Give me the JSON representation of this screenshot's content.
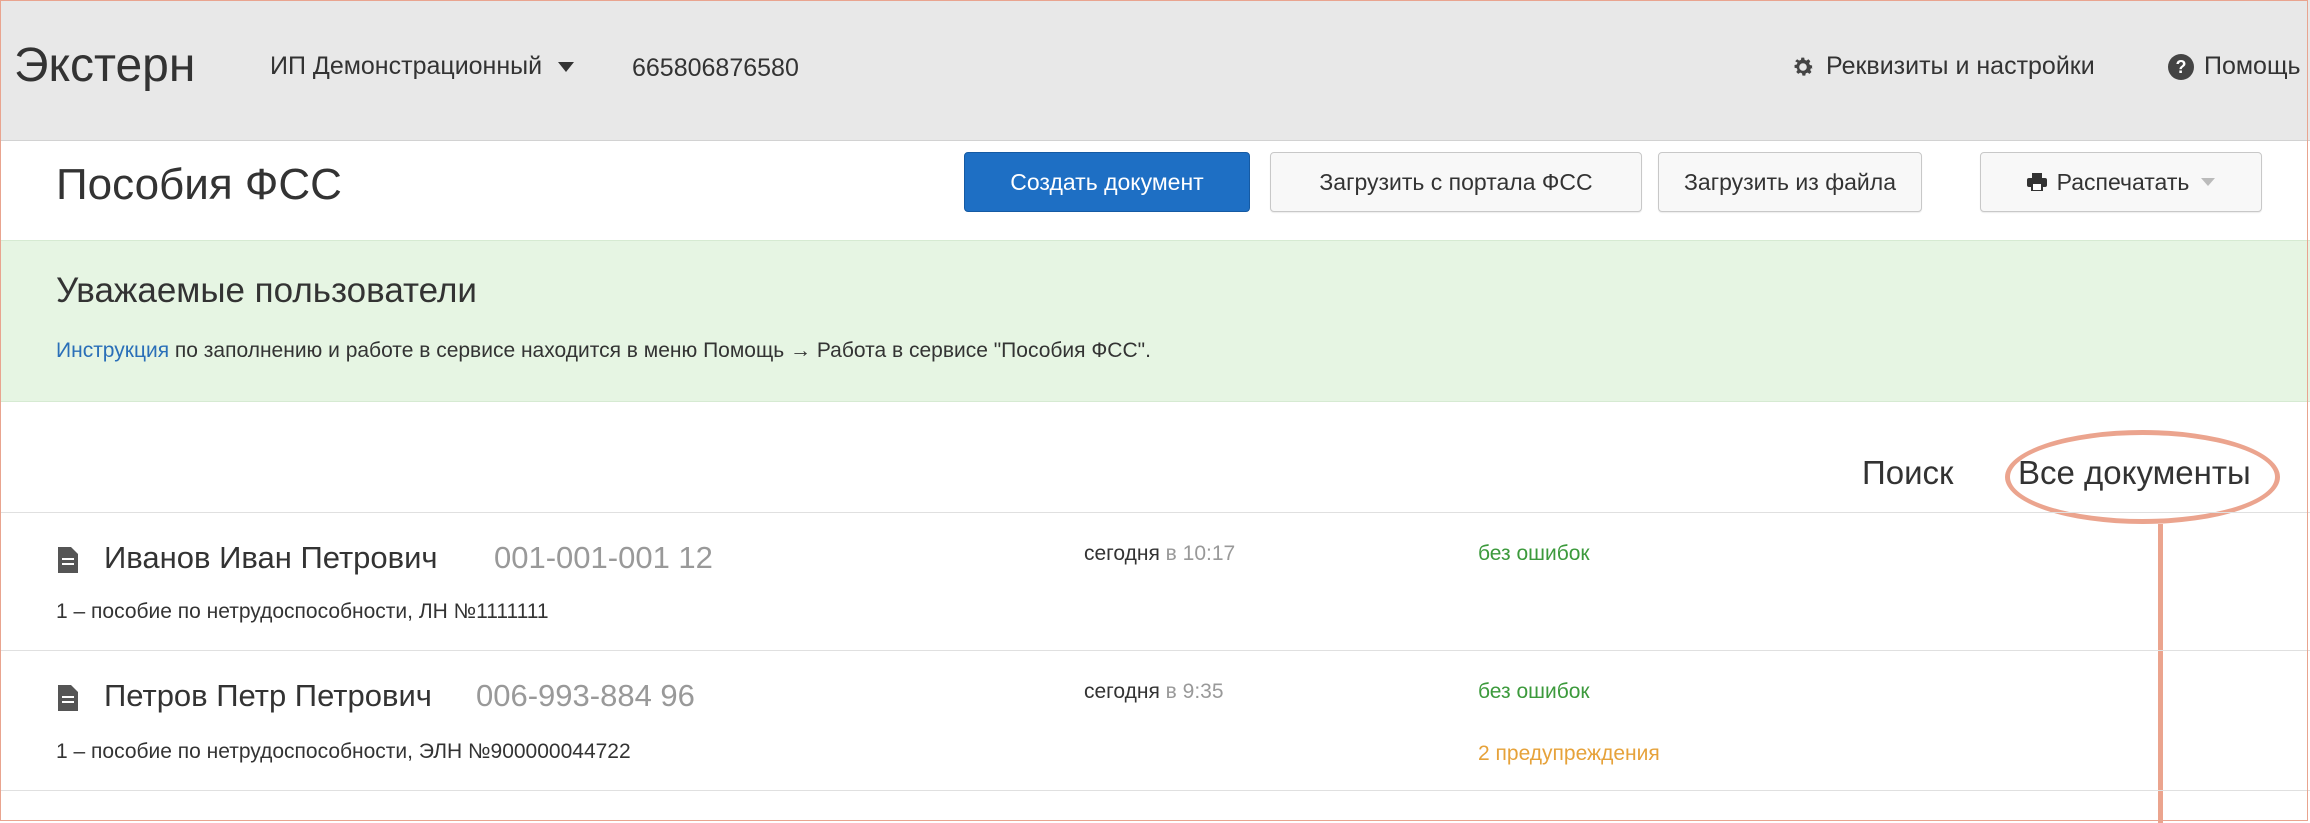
{
  "header": {
    "logo": "Экстерн",
    "org_name": "ИП Демонстрационный",
    "inn": "665806876580",
    "settings_label": "Реквизиты и настройки",
    "help_label": "Помощь"
  },
  "page": {
    "title": "Пособия ФСС",
    "buttons": {
      "create": "Создать документ",
      "load_portal": "Загрузить с портала ФСС",
      "load_file": "Загрузить из файла",
      "print": "Распечатать"
    }
  },
  "notice": {
    "title": "Уважаемые пользователи",
    "link": "Инструкция",
    "text": " по заполнению и работе в сервисе находится в меню Помощь → Работа в сервисе \"Пособия ФСС\"."
  },
  "filters": {
    "search": "Поиск",
    "all_docs": "Все документы"
  },
  "rows": [
    {
      "name": "Иванов Иван Петрович",
      "snils": "001-001-001 12",
      "subtitle": "1 – пособие по нетрудоспособности, ЛН №1111111",
      "date": "сегодня",
      "time": " в 10:17",
      "status": "без ошибок",
      "warnings": ""
    },
    {
      "name": "Петров Петр Петрович",
      "snils": "006-993-884 96",
      "subtitle": "1 – пособие по нетрудоспособности, ЭЛН №900000044722",
      "date": "сегодня",
      "time": " в 9:35",
      "status": "без ошибок",
      "warnings": "2 предупреждения"
    }
  ],
  "colors": {
    "primary": "#1e6fc4",
    "notice_bg": "#e6f5e3",
    "status_ok": "#3c9a3c",
    "status_warn": "#e6a23a",
    "annotation": "#eba48e"
  },
  "icons": [
    "gear-icon",
    "help-icon",
    "caret-down-icon",
    "print-icon",
    "document-icon"
  ]
}
